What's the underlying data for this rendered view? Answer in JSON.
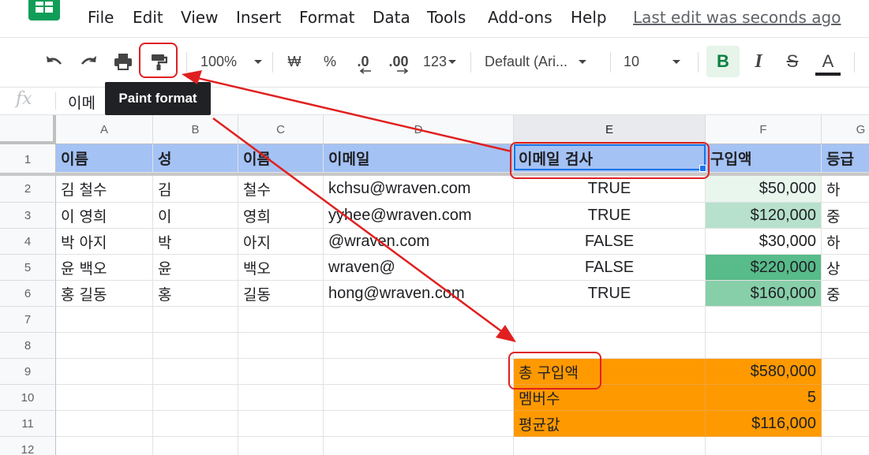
{
  "menu": {
    "items": [
      "File",
      "Edit",
      "View",
      "Insert",
      "Format",
      "Data",
      "Tools",
      "Add-ons",
      "Help"
    ],
    "last_edit": "Last edit was seconds ago"
  },
  "toolbar": {
    "zoom": "100%",
    "currency": "₩",
    "percent": "%",
    "decrease_decimal": ".0",
    "increase_decimal": ".00",
    "more_formats": "123",
    "font": "Default (Ari...",
    "font_size": "10",
    "bold": "B",
    "italic": "I",
    "strikethrough": "S",
    "text_color": "A",
    "icons": [
      "undo-icon",
      "redo-icon",
      "print-icon",
      "paint-format-icon",
      "text-color-icon"
    ]
  },
  "tooltip": "Paint format",
  "formula_bar": {
    "fx": "fx",
    "value": "이메"
  },
  "columns": [
    "A",
    "B",
    "C",
    "D",
    "E",
    "F",
    "G"
  ],
  "rows": [
    "1",
    "2",
    "3",
    "4",
    "5",
    "6",
    "7",
    "8",
    "9",
    "10",
    "11",
    "12"
  ],
  "header_row": [
    "이름",
    "성",
    "이름",
    "이메일",
    "이메일 검사",
    "구입액",
    "등급"
  ],
  "data_rows": [
    [
      "김 철수",
      "김",
      "철수",
      "kchsu@wraven.com",
      "TRUE",
      "$50,000",
      "하"
    ],
    [
      "이 영희",
      "이",
      "영희",
      "yyhee@wraven.com",
      "TRUE",
      "$120,000",
      "중"
    ],
    [
      "박 아지",
      "박",
      "아지",
      "@wraven.com",
      "FALSE",
      "$30,000",
      "하"
    ],
    [
      "윤 백오",
      "윤",
      "백오",
      "wraven@",
      "FALSE",
      "$220,000",
      "상"
    ],
    [
      "홍 길동",
      "홍",
      "길동",
      "hong@wraven.com",
      "TRUE",
      "$160,000",
      "중"
    ]
  ],
  "purchase_heat_colors": [
    "#e8f6ee",
    "#b7e1cd",
    "#ffffff",
    "#57bb8a",
    "#87cfa9"
  ],
  "summary": [
    {
      "label": "총 구입액",
      "value": "$580,000"
    },
    {
      "label": "멤버수",
      "value": "5"
    },
    {
      "label": "평균값",
      "value": "$116,000"
    }
  ],
  "colors": {
    "header_fill": "#a4c2f4",
    "summary_fill": "#ff9900",
    "annotation": "#e02020",
    "selection": "#1a73e8"
  }
}
